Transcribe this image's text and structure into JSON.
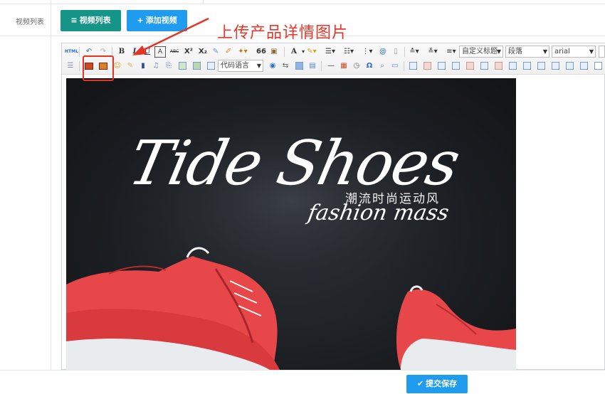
{
  "form": {
    "row_label": "视频列表"
  },
  "buttons": {
    "video_list": "视频列表",
    "video_list_icon": "list-icon",
    "add_video": "添加视频",
    "add_video_icon": "plus-icon",
    "save": "提交保存",
    "save_icon": "check-icon"
  },
  "annotation": {
    "text": "上传产品详情图片",
    "color": "#e8362a"
  },
  "editor": {
    "toolbar": {
      "html_label": "HTML",
      "bold": "B",
      "italic": "I",
      "strikethrough": "ABC",
      "superscript": "X²",
      "subscript": "X₂",
      "quote": "66",
      "font_color": "A",
      "custom_title_select": "自定义标题",
      "paragraph_select": "段落",
      "font_select": "arial",
      "code_language_select": "代码语言",
      "omega": "Ω"
    },
    "content_image": {
      "headline": "Tide Shoes",
      "cn_tagline": "潮流时尚运动风",
      "en_tagline": "fashion mass"
    }
  },
  "colors": {
    "primary_green": "#159488",
    "primary_blue": "#1f9cf0",
    "annotation_red": "#e53423"
  }
}
